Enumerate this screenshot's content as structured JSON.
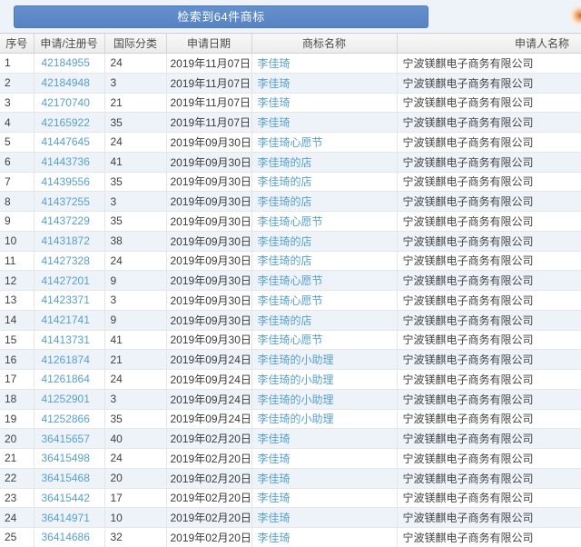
{
  "banner": {
    "result_count_label": "检索到64件商标"
  },
  "colors": {
    "banner_blue": "#5b87c6",
    "banner_border": "#4d7ab9",
    "link_blue": "#58a0cf",
    "row_alt_bg": "#eef3f9",
    "strip_bg": "#edf3f8",
    "header_text": "#4d4d4d",
    "body_text": "#404040",
    "widget_orange": "#e89a5e"
  },
  "table": {
    "headers": [
      "序号",
      "申请/注册号",
      "国际分类",
      "申请日期",
      "商标名称",
      "申请人名称"
    ],
    "rows": [
      [
        "1",
        "42184955",
        "24",
        "2019年11月07日",
        "李佳琦",
        "宁波镁麒电子商务有限公司"
      ],
      [
        "2",
        "42184948",
        "3",
        "2019年11月07日",
        "李佳琦",
        "宁波镁麒电子商务有限公司"
      ],
      [
        "3",
        "42170740",
        "21",
        "2019年11月07日",
        "李佳琦",
        "宁波镁麒电子商务有限公司"
      ],
      [
        "4",
        "42165922",
        "35",
        "2019年11月07日",
        "李佳琦",
        "宁波镁麒电子商务有限公司"
      ],
      [
        "5",
        "41447645",
        "24",
        "2019年09月30日",
        "李佳琦心愿节",
        "宁波镁麒电子商务有限公司"
      ],
      [
        "6",
        "41443736",
        "41",
        "2019年09月30日",
        "李佳琦的店",
        "宁波镁麒电子商务有限公司"
      ],
      [
        "7",
        "41439556",
        "35",
        "2019年09月30日",
        "李佳琦的店",
        "宁波镁麒电子商务有限公司"
      ],
      [
        "8",
        "41437255",
        "3",
        "2019年09月30日",
        "李佳琦的店",
        "宁波镁麒电子商务有限公司"
      ],
      [
        "9",
        "41437229",
        "35",
        "2019年09月30日",
        "李佳琦心愿节",
        "宁波镁麒电子商务有限公司"
      ],
      [
        "10",
        "41431872",
        "38",
        "2019年09月30日",
        "李佳琦的店",
        "宁波镁麒电子商务有限公司"
      ],
      [
        "11",
        "41427328",
        "24",
        "2019年09月30日",
        "李佳琦的店",
        "宁波镁麒电子商务有限公司"
      ],
      [
        "12",
        "41427201",
        "9",
        "2019年09月30日",
        "李佳琦心愿节",
        "宁波镁麒电子商务有限公司"
      ],
      [
        "13",
        "41423371",
        "3",
        "2019年09月30日",
        "李佳琦心愿节",
        "宁波镁麒电子商务有限公司"
      ],
      [
        "14",
        "41421741",
        "9",
        "2019年09月30日",
        "李佳琦的店",
        "宁波镁麒电子商务有限公司"
      ],
      [
        "15",
        "41413731",
        "41",
        "2019年09月30日",
        "李佳琦心愿节",
        "宁波镁麒电子商务有限公司"
      ],
      [
        "16",
        "41261874",
        "21",
        "2019年09月24日",
        "李佳琦的小助理",
        "宁波镁麒电子商务有限公司"
      ],
      [
        "17",
        "41261864",
        "24",
        "2019年09月24日",
        "李佳琦的小助理",
        "宁波镁麒电子商务有限公司"
      ],
      [
        "18",
        "41252901",
        "3",
        "2019年09月24日",
        "李佳琦的小助理",
        "宁波镁麒电子商务有限公司"
      ],
      [
        "19",
        "41252866",
        "35",
        "2019年09月24日",
        "李佳琦的小助理",
        "宁波镁麒电子商务有限公司"
      ],
      [
        "20",
        "36415657",
        "40",
        "2019年02月20日",
        "李佳琦",
        "宁波镁麒电子商务有限公司"
      ],
      [
        "21",
        "36415498",
        "24",
        "2019年02月20日",
        "李佳琦",
        "宁波镁麒电子商务有限公司"
      ],
      [
        "22",
        "36415468",
        "20",
        "2019年02月20日",
        "李佳琦",
        "宁波镁麒电子商务有限公司"
      ],
      [
        "23",
        "36415442",
        "17",
        "2019年02月20日",
        "李佳琦",
        "宁波镁麒电子商务有限公司"
      ],
      [
        "24",
        "36414971",
        "10",
        "2019年02月20日",
        "李佳琦",
        "宁波镁麒电子商务有限公司"
      ],
      [
        "25",
        "36414686",
        "32",
        "2019年02月20日",
        "李佳琦",
        "宁波镁麒电子商务有限公司"
      ]
    ]
  }
}
